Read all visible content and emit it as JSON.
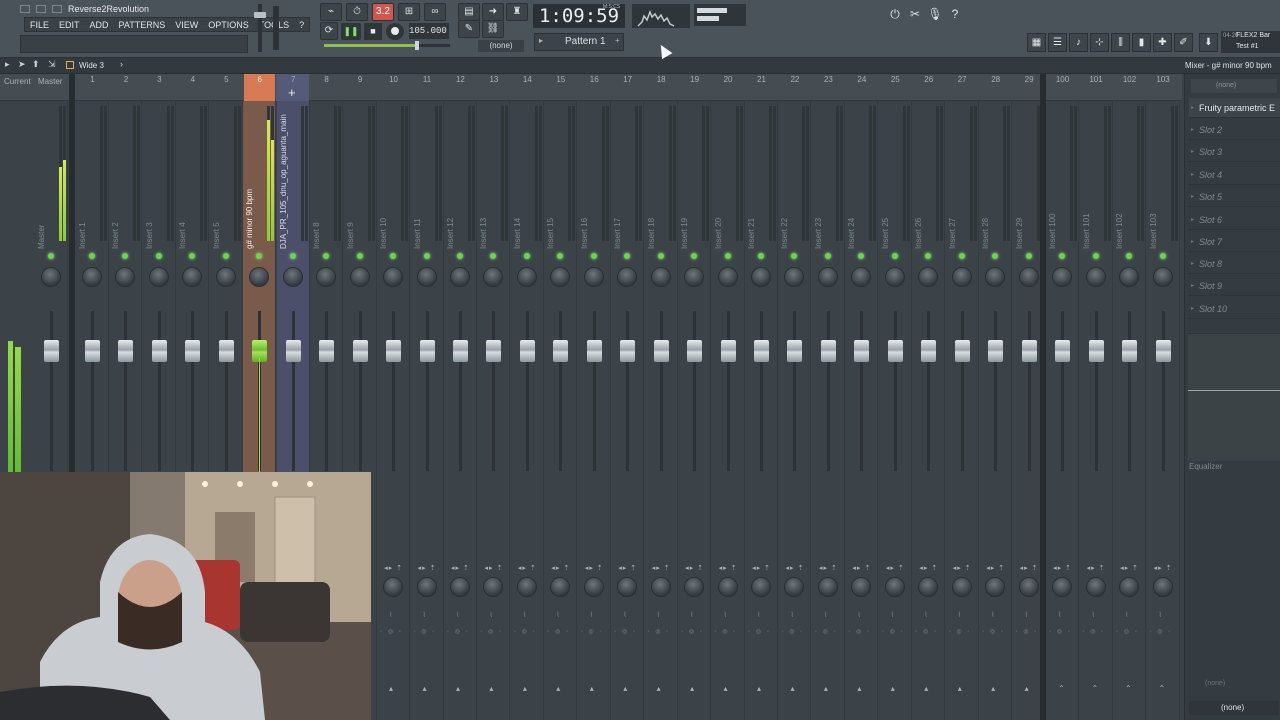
{
  "window": {
    "title": "Reverse2Revolution"
  },
  "menu": [
    "FILE",
    "EDIT",
    "ADD",
    "PATTERNS",
    "VIEW",
    "OPTIONS",
    "TOOLS",
    "?"
  ],
  "toolbar": {
    "tempo": "105.000",
    "snap": "(none)",
    "pattern": "Pattern 1",
    "clock": "1:09:59",
    "clock_unit": "M:S:CS",
    "mode_badge": "3.2",
    "news_date": "04-20",
    "news_line1": "FLEX2 Bar",
    "news_line2": "Test #1"
  },
  "mixer_header": {
    "preset": "Wide 3",
    "title": "Mixer - g# minor 90 bpm"
  },
  "mixer": {
    "current_label": "Current",
    "master_label": "Master",
    "strip_numbers": [
      "1",
      "2",
      "3",
      "4",
      "5",
      "6",
      "7",
      "8",
      "9",
      "10",
      "11",
      "12",
      "13",
      "14",
      "15",
      "16",
      "17",
      "18",
      "19",
      "20",
      "21",
      "22",
      "23",
      "24",
      "25",
      "26",
      "27",
      "28",
      "29",
      "100",
      "101",
      "102",
      "103"
    ],
    "strip_names": [
      "Master",
      "Insert 1",
      "Insert 2",
      "Insert 3",
      "Insert 4",
      "Insert 5",
      "g# minor 90 bpm",
      "DJA_PR_105_dnu_op_aguanta_main",
      "Insert 8",
      "Insert 9",
      "Insert 10",
      "Insert 11",
      "Insert 12",
      "Insert 13",
      "Insert 14",
      "Insert 15",
      "Insert 16",
      "Insert 17",
      "Insert 18",
      "Insert 19",
      "Insert 20",
      "Insert 21",
      "Insert 22",
      "Insert 23",
      "Insert 24",
      "Insert 25",
      "Insert 26",
      "Insert 27",
      "Insert 28",
      "Insert 29",
      "Insert 100",
      "Insert 101",
      "Insert 102",
      "Insert 103"
    ],
    "selected_strip": "6"
  },
  "effects": {
    "none_label": "(none)",
    "slots": [
      "Fruity parametric E",
      "Slot 2",
      "Slot 3",
      "Slot 4",
      "Slot 5",
      "Slot 6",
      "Slot 7",
      "Slot 8",
      "Slot 9",
      "Slot 10"
    ],
    "eq_label": "Equalizer",
    "out_label": "(none)",
    "out_label2": "(none)"
  },
  "colors": {
    "selected_strip": "#7a5a4b",
    "accent_green": "#8fd13a",
    "link_strip": "#4c4f6a"
  }
}
